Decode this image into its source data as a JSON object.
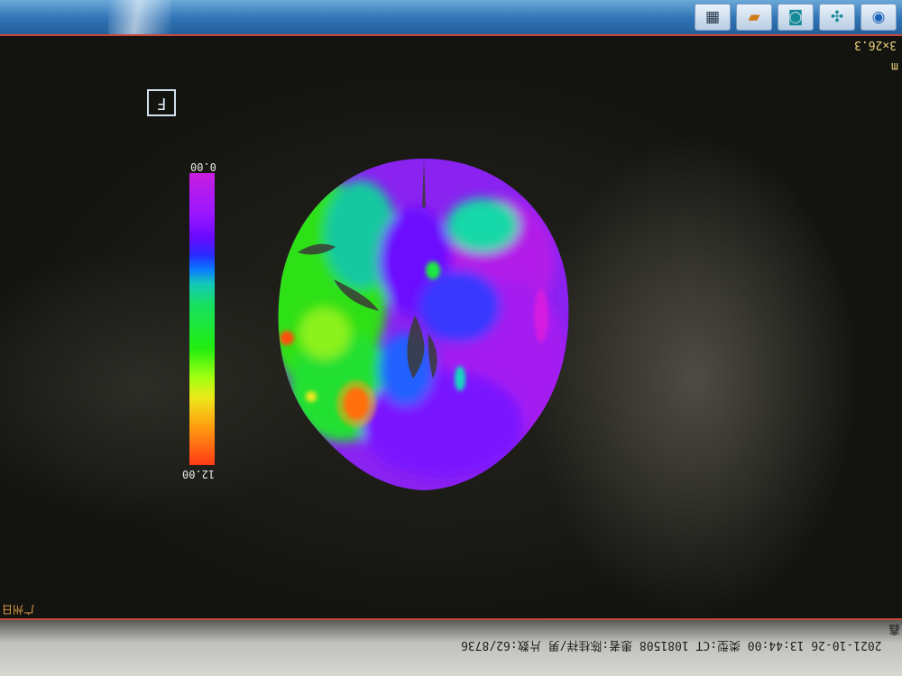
{
  "window": {
    "tray_icons": [
      "calculator-icon",
      "folder-icon",
      "settings-icon",
      "tools-icon",
      "browser-icon"
    ]
  },
  "overlay": {
    "matrix_label": "3×26.3",
    "unit_label": "m",
    "orientation_marker": "F"
  },
  "color_scale": {
    "top_value": "0.00",
    "bottom_value": "12.00",
    "colors": [
      "#c81ee0",
      "#6a0aff",
      "#0a7aff",
      "#16e060",
      "#eee81a",
      "#ff3a16"
    ]
  },
  "status": {
    "info_line": "2021-10-26 13:44:00 类型:CT 1081508 患者:陈桂祥/男 片数:62/8736",
    "corner_label": "鑫",
    "left_label": "广州日"
  }
}
